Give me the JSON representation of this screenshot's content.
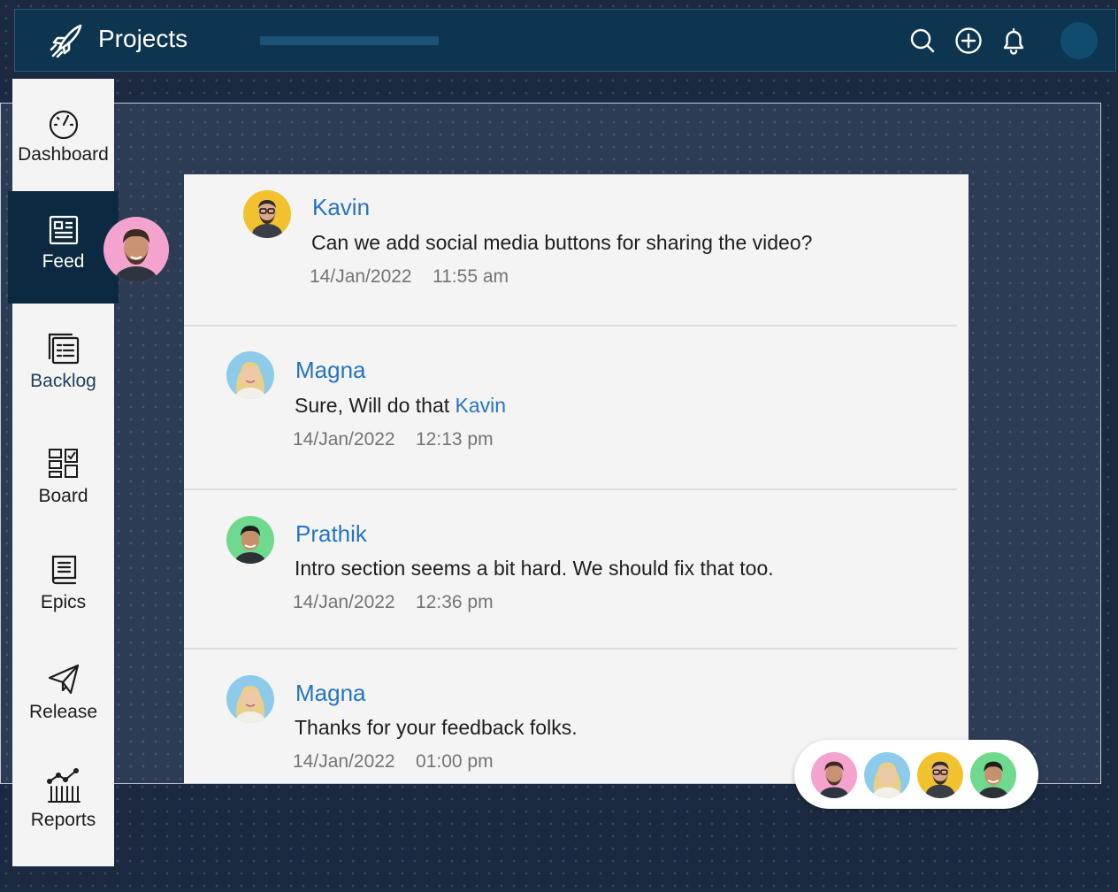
{
  "app": {
    "title": "Projects"
  },
  "header": {
    "icons": [
      "search-icon",
      "add-icon",
      "bell-icon",
      "user-avatar"
    ]
  },
  "sidebar": {
    "items": [
      {
        "label": "Dashboard",
        "icon": "speedometer-icon"
      },
      {
        "label": "Feed",
        "icon": "newspaper-icon",
        "active": true
      },
      {
        "label": "Backlog",
        "icon": "clipboard-list-icon"
      },
      {
        "label": "Board",
        "icon": "board-grid-icon"
      },
      {
        "label": "Epics",
        "icon": "book-icon"
      },
      {
        "label": "Release",
        "icon": "paper-plane-icon"
      },
      {
        "label": "Reports",
        "icon": "bar-chart-icon"
      }
    ]
  },
  "feed": {
    "posts": [
      {
        "author": "Kavin",
        "text": "Can we add social media buttons for sharing the video?",
        "date": "14/Jan/2022",
        "time": "11:55 am",
        "avatar_color": "#f2c12e"
      },
      {
        "author": "Magna",
        "text": "Sure, Will do that ",
        "mention": "Kavin",
        "date": "14/Jan/2022",
        "time": "12:13 pm",
        "avatar_color": "#8ecbea"
      },
      {
        "author": "Prathik",
        "text": "Intro section seems a bit hard. We should fix that too.",
        "date": "14/Jan/2022",
        "time": "12:36 pm",
        "avatar_color": "#6fd98e"
      },
      {
        "author": "Magna",
        "text": "Thanks for your feedback folks.",
        "date": "14/Jan/2022",
        "time": "01:00 pm",
        "avatar_color": "#8ecbea"
      }
    ]
  },
  "participants": [
    {
      "avatar_color": "#f3a3ce"
    },
    {
      "avatar_color": "#8ecbea"
    },
    {
      "avatar_color": "#f2c12e"
    },
    {
      "avatar_color": "#6fd98e"
    }
  ],
  "colors": {
    "header_bg": "#0e3550",
    "sidebar_active": "#0b2a41",
    "link": "#2574c4"
  }
}
